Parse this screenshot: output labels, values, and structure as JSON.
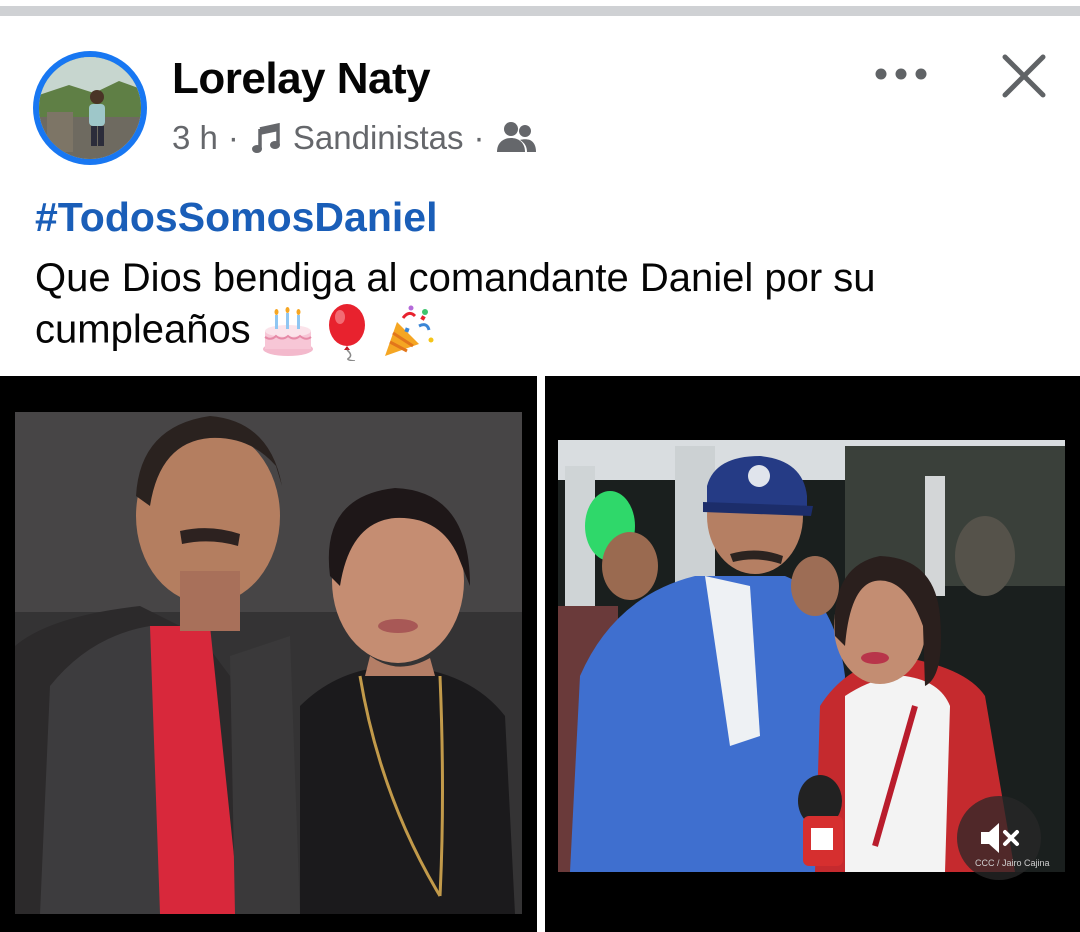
{
  "post": {
    "author": "Lorelay Naty",
    "time": "3 h",
    "separator": "·",
    "group": "Sandinistas",
    "hashtag": "#TodosSomosDaniel",
    "text": "Que Dios bendiga al comandante Daniel por su cumpleaños"
  },
  "icons": {
    "more": "more-options-icon",
    "close": "close-icon",
    "music": "music-note-icon",
    "audience": "people-icon",
    "mute": "speaker-muted-icon",
    "emojis": [
      "birthday-cake-icon",
      "balloon-icon",
      "party-popper-icon"
    ]
  },
  "video": {
    "credit": "CCC / Jairo Cajina"
  },
  "colors": {
    "accent": "#1877f2",
    "hashtag": "#1a5eb8",
    "secondary_text": "#65676b",
    "text": "#050505"
  }
}
